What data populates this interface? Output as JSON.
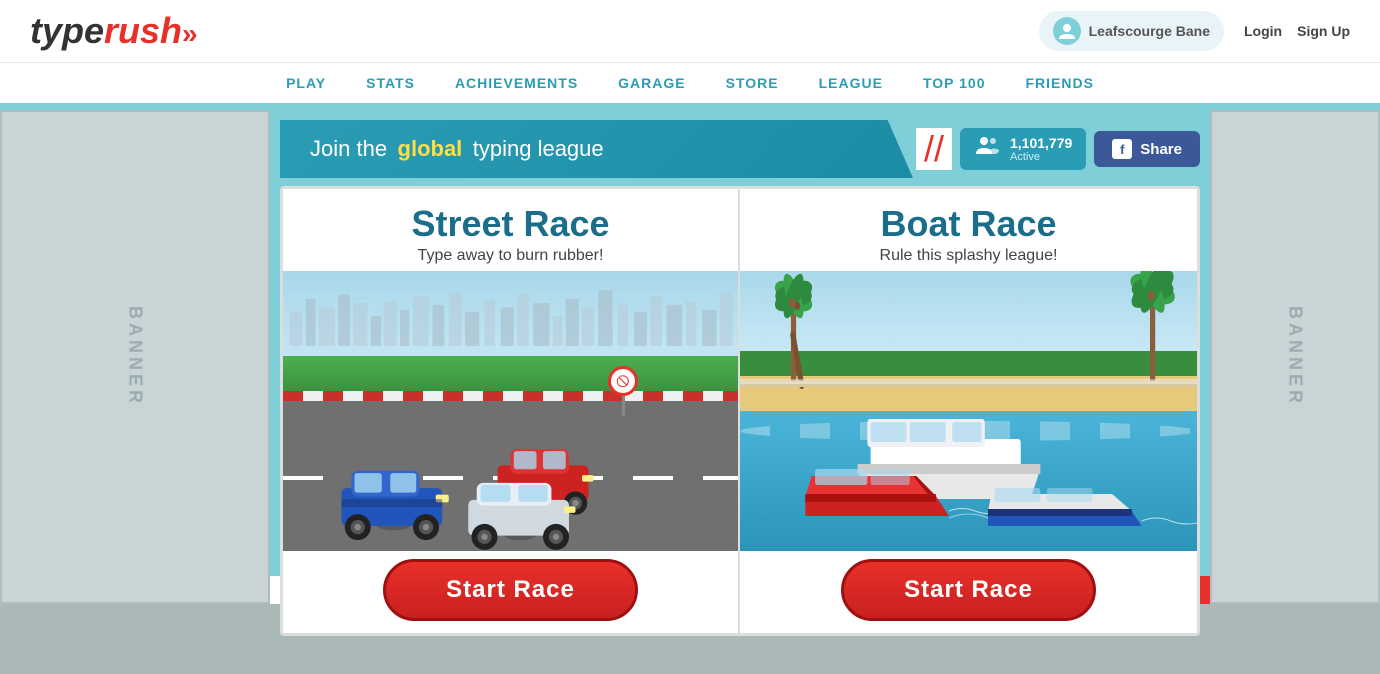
{
  "header": {
    "logo": {
      "type_text": "type",
      "rush_text": "rush",
      "arrows": "»"
    },
    "user": {
      "name": "Leafscourge Bane"
    },
    "auth": {
      "login": "Login",
      "signup": "Sign Up"
    }
  },
  "nav": {
    "items": [
      {
        "label": "PLAY",
        "id": "play"
      },
      {
        "label": "STATS",
        "id": "stats"
      },
      {
        "label": "ACHIEVEMENTS",
        "id": "achievements"
      },
      {
        "label": "GARAGE",
        "id": "garage"
      },
      {
        "label": "STORE",
        "id": "store"
      },
      {
        "label": "LEAGUE",
        "id": "league"
      },
      {
        "label": "TOP 100",
        "id": "top100"
      },
      {
        "label": "FRIENDS",
        "id": "friends"
      }
    ]
  },
  "join_banner": {
    "join_the": "Join the",
    "global": "global",
    "typing_league": "typing league",
    "slash": "//",
    "active_count": "1,101,779",
    "active_label": "Active",
    "share_label": "Share"
  },
  "banner_left": {
    "text": "B\nA\nN\nN\nE\nR"
  },
  "banner_right": {
    "text": "B\nA\nN\nN\nE\nR"
  },
  "street_race": {
    "title": "Street Race",
    "subtitle": "Type away to burn rubber!",
    "button": "Start Race"
  },
  "boat_race": {
    "title": "Boat Race",
    "subtitle": "Rule this splashy league!",
    "button": "Start Race"
  }
}
